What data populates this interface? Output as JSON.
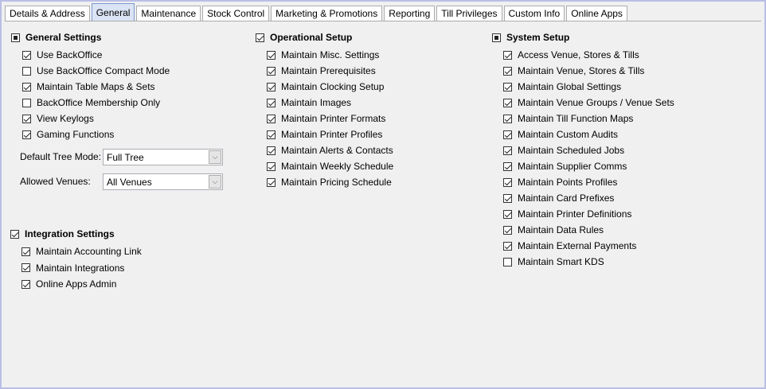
{
  "tabs": [
    "Details & Address",
    "General",
    "Maintenance",
    "Stock Control",
    "Marketing & Promotions",
    "Reporting",
    "Till Privileges",
    "Custom Info",
    "Online Apps"
  ],
  "active_tab": 1,
  "general_settings": {
    "header": "General Settings",
    "header_state": "indeterminate",
    "items": [
      {
        "label": "Use BackOffice",
        "checked": true
      },
      {
        "label": "Use BackOffice Compact Mode",
        "checked": false
      },
      {
        "label": "Maintain Table Maps & Sets",
        "checked": true
      },
      {
        "label": "BackOffice Membership Only",
        "checked": false
      },
      {
        "label": "View Keylogs",
        "checked": true
      },
      {
        "label": "Gaming Functions",
        "checked": true
      }
    ],
    "default_tree_mode_label": "Default Tree Mode:",
    "default_tree_mode_value": "Full Tree",
    "allowed_venues_label": "Allowed Venues:",
    "allowed_venues_value": "All Venues"
  },
  "integration_settings": {
    "header": "Integration Settings",
    "header_state": "checked",
    "items": [
      {
        "label": "Maintain Accounting Link",
        "checked": true
      },
      {
        "label": "Maintain Integrations",
        "checked": true
      },
      {
        "label": "Online Apps Admin",
        "checked": true
      }
    ]
  },
  "operational_setup": {
    "header": "Operational Setup",
    "header_state": "checked",
    "items": [
      {
        "label": "Maintain Misc. Settings",
        "checked": true
      },
      {
        "label": "Maintain Prerequisites",
        "checked": true
      },
      {
        "label": "Maintain Clocking Setup",
        "checked": true
      },
      {
        "label": "Maintain Images",
        "checked": true
      },
      {
        "label": "Maintain Printer Formats",
        "checked": true
      },
      {
        "label": "Maintain Printer Profiles",
        "checked": true
      },
      {
        "label": "Maintain Alerts & Contacts",
        "checked": true
      },
      {
        "label": "Maintain Weekly Schedule",
        "checked": true
      },
      {
        "label": "Maintain Pricing Schedule",
        "checked": true
      }
    ]
  },
  "system_setup": {
    "header": "System Setup",
    "header_state": "indeterminate",
    "items": [
      {
        "label": "Access Venue, Stores & Tills",
        "checked": true
      },
      {
        "label": "Maintain Venue, Stores & Tills",
        "checked": true
      },
      {
        "label": "Maintain Global Settings",
        "checked": true
      },
      {
        "label": "Maintain Venue Groups / Venue Sets",
        "checked": true
      },
      {
        "label": "Maintain Till Function Maps",
        "checked": true
      },
      {
        "label": "Maintain Custom Audits",
        "checked": true
      },
      {
        "label": "Maintain Scheduled Jobs",
        "checked": true
      },
      {
        "label": "Maintain Supplier Comms",
        "checked": true
      },
      {
        "label": "Maintain Points Profiles",
        "checked": true
      },
      {
        "label": "Maintain Card Prefixes",
        "checked": true
      },
      {
        "label": "Maintain Printer Definitions",
        "checked": true
      },
      {
        "label": "Maintain Data Rules",
        "checked": true
      },
      {
        "label": "Maintain External Payments",
        "checked": true
      },
      {
        "label": "Maintain Smart KDS",
        "checked": false
      }
    ]
  }
}
